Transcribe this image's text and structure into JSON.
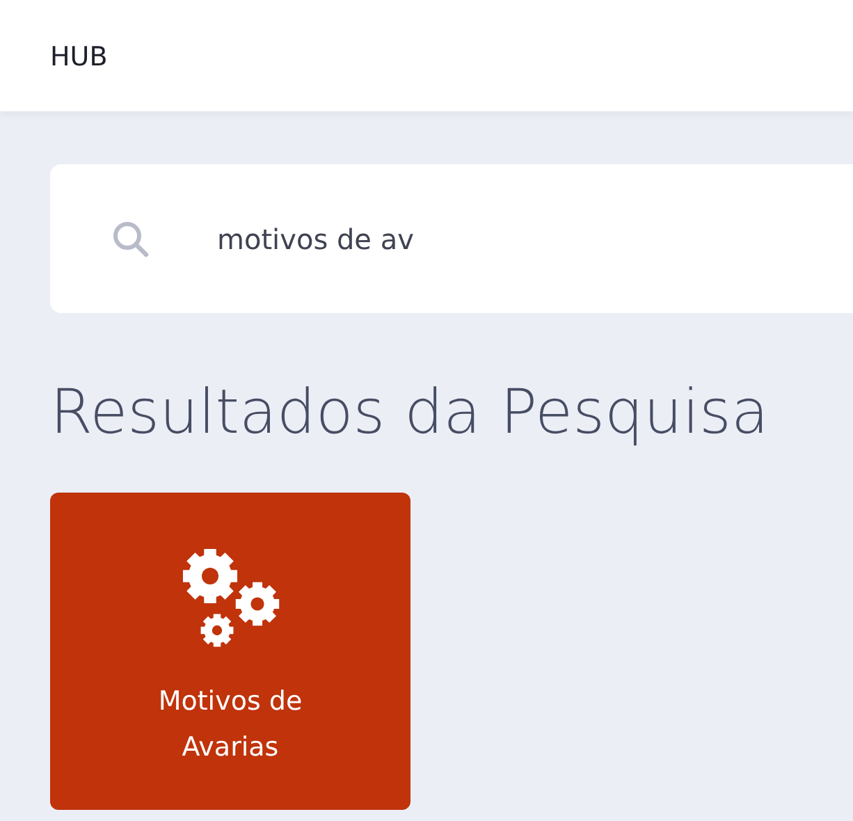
{
  "header": {
    "title": "HUB"
  },
  "search": {
    "value": "motivos de av"
  },
  "results": {
    "heading": "Resultados da Pesquisa",
    "tiles": [
      {
        "label": "Motivos de Avarias",
        "color": "#c0330b"
      }
    ]
  }
}
